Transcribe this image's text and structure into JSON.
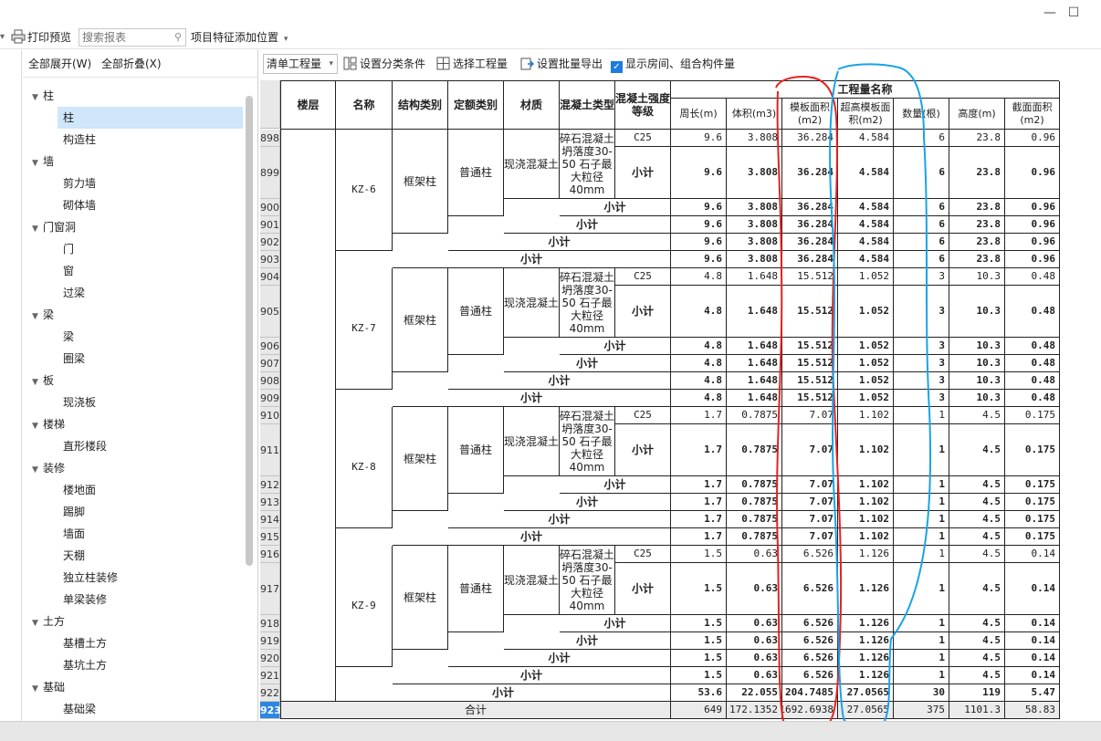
{
  "window": {
    "minimize": "—",
    "maximize": "☐"
  },
  "toolbar": {
    "print_preview": "打印预览",
    "search_placeholder": "搜索报表",
    "project_feature": "项目特征添加位置"
  },
  "tree_toolbar": {
    "expand_all": "全部展开(W)",
    "collapse_all": "全部折叠(X)"
  },
  "tree": [
    {
      "label": "柱",
      "level": 0
    },
    {
      "label": "柱",
      "level": 1,
      "selected": true
    },
    {
      "label": "构造柱",
      "level": 1
    },
    {
      "label": "墙",
      "level": 0
    },
    {
      "label": "剪力墙",
      "level": 1
    },
    {
      "label": "砌体墙",
      "level": 1
    },
    {
      "label": "门窗洞",
      "level": 0
    },
    {
      "label": "门",
      "level": 1
    },
    {
      "label": "窗",
      "level": 1
    },
    {
      "label": "过梁",
      "level": 1
    },
    {
      "label": "梁",
      "level": 0
    },
    {
      "label": "梁",
      "level": 1
    },
    {
      "label": "圈梁",
      "level": 1
    },
    {
      "label": "板",
      "level": 0
    },
    {
      "label": "现浇板",
      "level": 1
    },
    {
      "label": "楼梯",
      "level": 0
    },
    {
      "label": "直形楼段",
      "level": 1
    },
    {
      "label": "装修",
      "level": 0
    },
    {
      "label": "楼地面",
      "level": 1
    },
    {
      "label": "踢脚",
      "level": 1
    },
    {
      "label": "墙面",
      "level": 1
    },
    {
      "label": "天棚",
      "level": 1
    },
    {
      "label": "独立柱装修",
      "level": 1
    },
    {
      "label": "单梁装修",
      "level": 1
    },
    {
      "label": "土方",
      "level": 0
    },
    {
      "label": "基槽土方",
      "level": 1
    },
    {
      "label": "基坑土方",
      "level": 1
    },
    {
      "label": "基础",
      "level": 0
    },
    {
      "label": "基础梁",
      "level": 1
    }
  ],
  "grid_toolbar": {
    "mode": "清单工程量",
    "classify": "设置分类条件",
    "select_qty": "选择工程量",
    "batch_export": "设置批量导出",
    "show_room": "显示房间、组合构件量"
  },
  "headers": {
    "floor": "楼层",
    "name": "名称",
    "struct": "结构类别",
    "quota": "定额类别",
    "material": "材质",
    "concrete_type": "混凝土类型",
    "concrete_grade": "混凝土强度等级",
    "qty_group": "工程量名称",
    "perimeter": "周长(m)",
    "volume": "体积(m3)",
    "formwork": "模板面积(m2)",
    "super_formwork": "超高模板面积(m2)",
    "count": "数量(根)",
    "height": "高度(m)",
    "section": "截面面积(m2)"
  },
  "labels": {
    "subtotal": "小计",
    "total": "合计"
  },
  "groups": [
    {
      "start": 898,
      "name": "KZ-6",
      "struct": "框架柱",
      "quota": "普通柱",
      "material": "现浇混凝土",
      "ctype": "碎石混凝土 坍落度30-50 石子最大粒径40mm",
      "grade": "C25",
      "vals": [
        "9.6",
        "3.808",
        "36.284",
        "4.584",
        "6",
        "23.8",
        "0.96"
      ]
    },
    {
      "start": 904,
      "name": "KZ-7",
      "struct": "框架柱",
      "quota": "普通柱",
      "material": "现浇混凝土",
      "ctype": "碎石混凝土 坍落度30-50 石子最大粒径40mm",
      "grade": "C25",
      "vals": [
        "4.8",
        "1.648",
        "15.512",
        "1.052",
        "3",
        "10.3",
        "0.48"
      ]
    },
    {
      "start": 910,
      "name": "KZ-8",
      "struct": "框架柱",
      "quota": "普通柱",
      "material": "现浇混凝土",
      "ctype": "碎石混凝土 坍落度30-50 石子最大粒径40mm",
      "grade": "C25",
      "vals": [
        "1.7",
        "0.7875",
        "7.07",
        "1.102",
        "1",
        "4.5",
        "0.175"
      ]
    },
    {
      "start": 916,
      "name": "KZ-9",
      "struct": "框架柱",
      "quota": "普通柱",
      "material": "现浇混凝土",
      "ctype": "碎石混凝土 坍落度30-50 石子最大粒径40mm",
      "grade": "C25",
      "vals": [
        "1.5",
        "0.63",
        "6.526",
        "1.126",
        "1",
        "4.5",
        "0.14"
      ]
    }
  ],
  "floor_subtotal": {
    "row": 922,
    "vals": [
      "53.6",
      "22.055",
      "204.7485",
      "27.0565",
      "30",
      "119",
      "5.47"
    ]
  },
  "grand_total": {
    "row": 923,
    "vals": [
      "649",
      "172.1352",
      "1692.6938",
      "27.0565",
      "375",
      "1101.3",
      "58.83"
    ]
  }
}
